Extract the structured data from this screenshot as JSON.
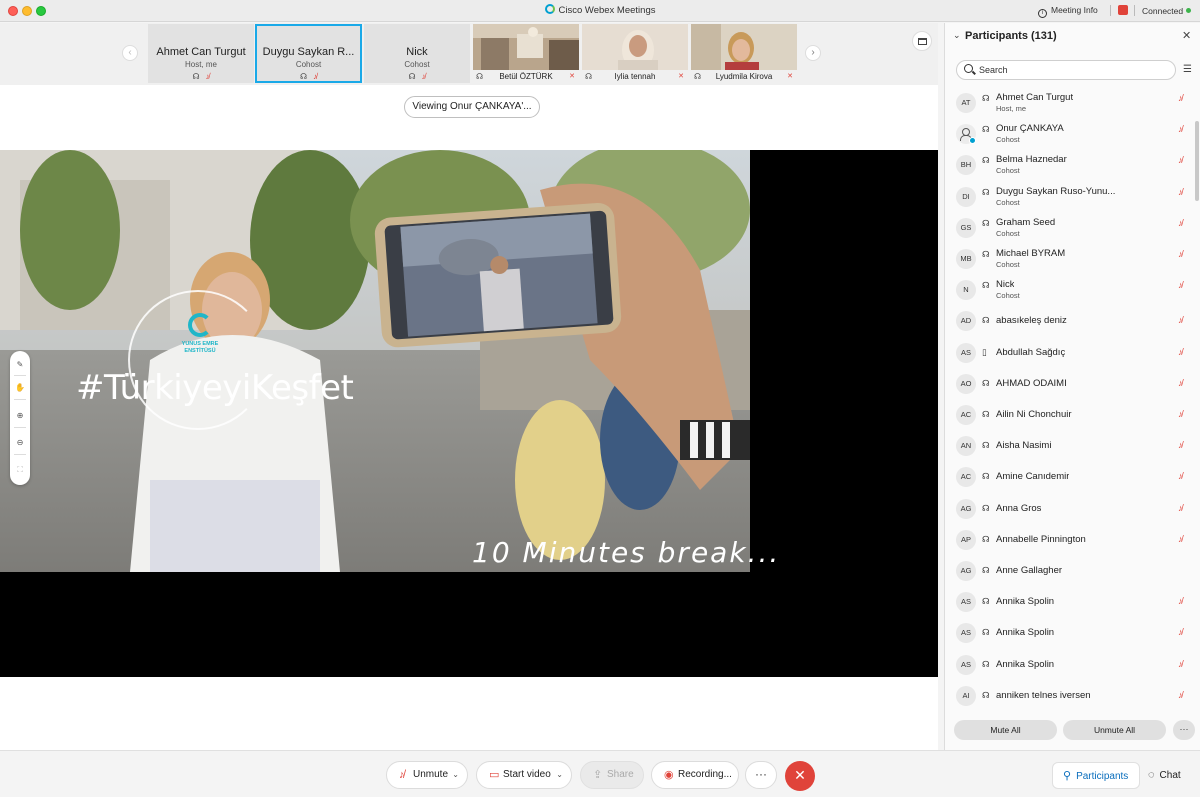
{
  "app": {
    "title": "Cisco Webex Meetings",
    "meeting_info_label": "Meeting Info",
    "connection_status": "Connected"
  },
  "filmstrip": {
    "tiles": [
      {
        "name": "Ahmet Can Turgut",
        "role": "Host, me"
      },
      {
        "name": "Duygu Saykan R...",
        "role": "Cohost"
      },
      {
        "name": "Nick",
        "role": "Cohost"
      }
    ],
    "video_tiles": [
      {
        "name": "Betül ÖZTÜRK"
      },
      {
        "name": "Iylia tennah"
      },
      {
        "name": "Lyudmila Kirova"
      }
    ]
  },
  "stage": {
    "viewing_label": "Viewing Onur ÇANKAYA'...",
    "share_hashtag": "#TürkiyeyiKeşfet",
    "share_logo_text": "YUNUS EMRE ENSTİTÜSÜ",
    "share_caption": "10 Minutes break..."
  },
  "participants_panel": {
    "title": "Participants (131)",
    "search_placeholder": "Search",
    "mute_all_label": "Mute All",
    "unmute_all_label": "Unmute All",
    "participants": [
      {
        "initials": "AT",
        "name": "Ahmet Can Turgut",
        "role": "Host, me",
        "device": "headset",
        "muted": true
      },
      {
        "initials": "",
        "name": "Onur ÇANKAYA",
        "role": "Cohost",
        "device": "headset",
        "muted": true,
        "avatar": "user-icon"
      },
      {
        "initials": "BH",
        "name": "Belma Haznedar",
        "role": "Cohost",
        "device": "headset",
        "muted": true
      },
      {
        "initials": "DI",
        "name": "Duygu Saykan Ruso-Yunu...",
        "role": "Cohost",
        "device": "headset",
        "muted": true
      },
      {
        "initials": "GS",
        "name": "Graham Seed",
        "role": "Cohost",
        "device": "headset",
        "muted": true
      },
      {
        "initials": "MB",
        "name": "Michael BYRAM",
        "role": "Cohost",
        "device": "headset",
        "muted": true
      },
      {
        "initials": "N",
        "name": "Nick",
        "role": "Cohost",
        "device": "headset",
        "muted": true
      },
      {
        "initials": "AD",
        "name": "abasıkeleş deniz",
        "role": "",
        "device": "headset",
        "muted": true
      },
      {
        "initials": "AS",
        "name": "Abdullah Sağdıç",
        "role": "",
        "device": "phone",
        "muted": true
      },
      {
        "initials": "AO",
        "name": "AHMAD ODAIMI",
        "role": "",
        "device": "headset",
        "muted": true
      },
      {
        "initials": "AC",
        "name": "Ailin Ni Chonchuir",
        "role": "",
        "device": "headset",
        "muted": true
      },
      {
        "initials": "AN",
        "name": "Aisha Nasimi",
        "role": "",
        "device": "headset",
        "muted": true
      },
      {
        "initials": "AC",
        "name": "Amine Canıdemir",
        "role": "",
        "device": "headset",
        "muted": true
      },
      {
        "initials": "AG",
        "name": "Anna Gros",
        "role": "",
        "device": "headset",
        "muted": true
      },
      {
        "initials": "AP",
        "name": "Annabelle Pinnington",
        "role": "",
        "device": "headset",
        "muted": true
      },
      {
        "initials": "AG",
        "name": "Anne Gallagher",
        "role": "",
        "device": "headset",
        "muted": false
      },
      {
        "initials": "AS",
        "name": "Annika Spolin",
        "role": "",
        "device": "headset",
        "muted": true
      },
      {
        "initials": "AS",
        "name": "Annika Spolin",
        "role": "",
        "device": "headset",
        "muted": true
      },
      {
        "initials": "AS",
        "name": "Annika Spolin",
        "role": "",
        "device": "headset",
        "muted": true
      },
      {
        "initials": "AI",
        "name": "anniken telnes iversen",
        "role": "",
        "device": "headset",
        "muted": true
      }
    ]
  },
  "controls": {
    "unmute_label": "Unmute",
    "start_video_label": "Start video",
    "share_label": "Share",
    "recording_label": "Recording...",
    "more_label": "···",
    "participants_tab_label": "Participants",
    "chat_tab_label": "Chat"
  },
  "colors": {
    "accent": "#1aa9e8",
    "muted_red": "#e0433a",
    "leave_red": "#e0433a",
    "connected_green": "#3cb44b"
  }
}
